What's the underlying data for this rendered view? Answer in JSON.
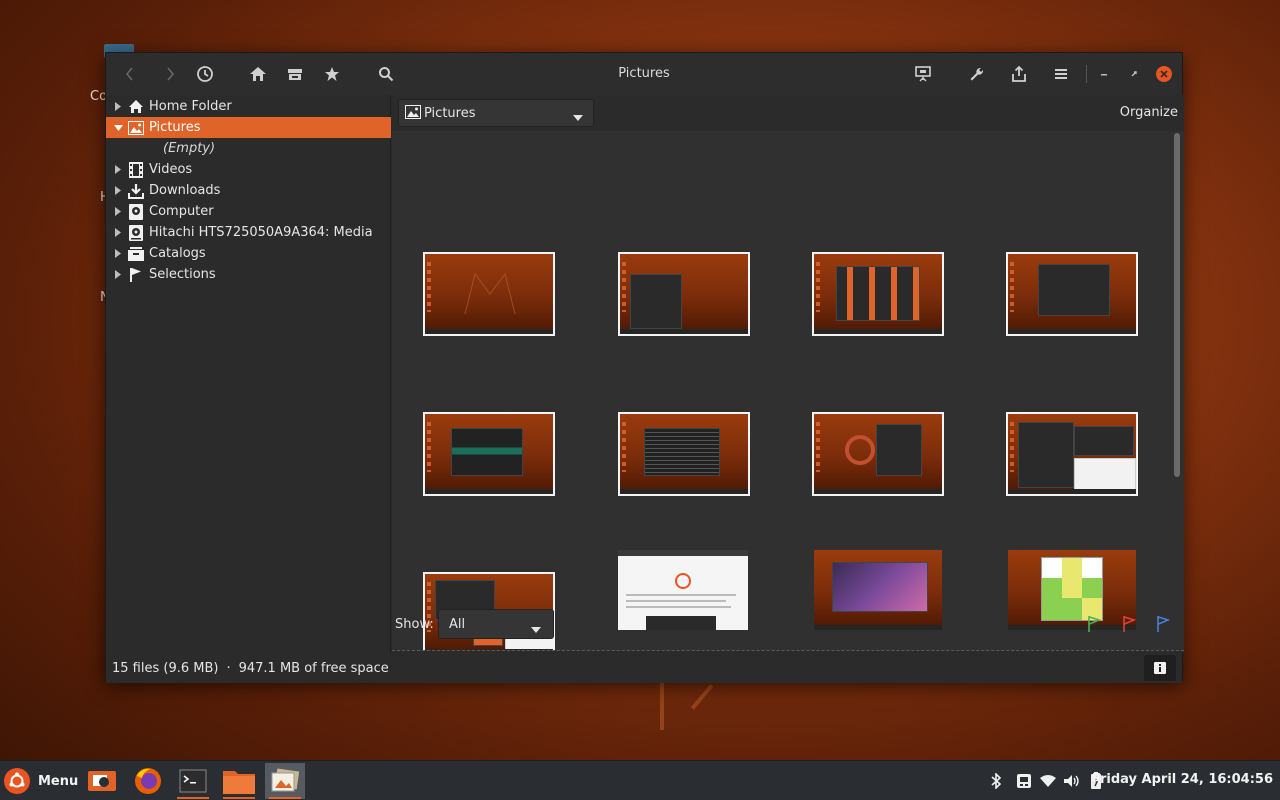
{
  "theme": {
    "accent": "#e0642a",
    "close": "#e95420",
    "window_bg": "#2b2b2b"
  },
  "desktop": {
    "labels": [
      "Co",
      "H",
      "N"
    ]
  },
  "window": {
    "title": "Pictures",
    "toolbar": {
      "icons": [
        "back-icon",
        "forward-icon",
        "history-icon",
        "home-icon",
        "drive-icon",
        "star-icon",
        "search-icon",
        "presentation-icon",
        "wrench-icon",
        "share-icon",
        "hamburger-menu-icon",
        "minimize-icon",
        "restore-icon",
        "close-icon"
      ]
    }
  },
  "sidebar": {
    "items": [
      {
        "label": "Home Folder",
        "icon": "home-icon",
        "expanded": false
      },
      {
        "label": "Pictures",
        "icon": "pictures-icon",
        "expanded": true,
        "selected": true
      },
      {
        "label": "(Empty)"
      },
      {
        "label": "Videos",
        "icon": "film-icon",
        "expanded": false
      },
      {
        "label": "Downloads",
        "icon": "download-icon",
        "expanded": false
      },
      {
        "label": "Computer",
        "icon": "computer-icon",
        "expanded": false
      },
      {
        "label": "Hitachi HTS725050A9A364: Media",
        "icon": "harddisk-icon",
        "expanded": false
      },
      {
        "label": "Catalogs",
        "icon": "catalog-icon",
        "expanded": false
      },
      {
        "label": "Selections",
        "icon": "flag-icon",
        "expanded": false
      }
    ]
  },
  "main": {
    "location": "Pictures",
    "organize": "Organize",
    "show_label": "Show:",
    "show_value": "All",
    "flags": [
      "#4caf50",
      "#e04040",
      "#4a7fd4"
    ],
    "thumbnails": [
      {
        "style": "wallpaper"
      },
      {
        "style": "file-manager"
      },
      {
        "style": "folder-grid"
      },
      {
        "style": "system-monitor"
      },
      {
        "style": "terminal-green"
      },
      {
        "style": "terminal-table"
      },
      {
        "style": "ubuntu-logo-terminal"
      },
      {
        "style": "multi-window"
      },
      {
        "style": "multi-window-2"
      },
      {
        "style": "webpage"
      },
      {
        "style": "video-player"
      },
      {
        "style": "sudoku-game"
      }
    ]
  },
  "status": {
    "files": "15 files (9.6 MB)",
    "free_space": "947.1 MB of free space"
  },
  "taskbar": {
    "menu_label": "Menu",
    "apps": [
      "screenshot-app-icon",
      "firefox-icon",
      "terminal-icon",
      "files-icon",
      "gthumb-icon"
    ],
    "tray": [
      "bluetooth-icon",
      "network-icon",
      "wifi-icon",
      "volume-icon",
      "battery-icon"
    ],
    "clock": "Friday April 24, 16:04:56"
  }
}
